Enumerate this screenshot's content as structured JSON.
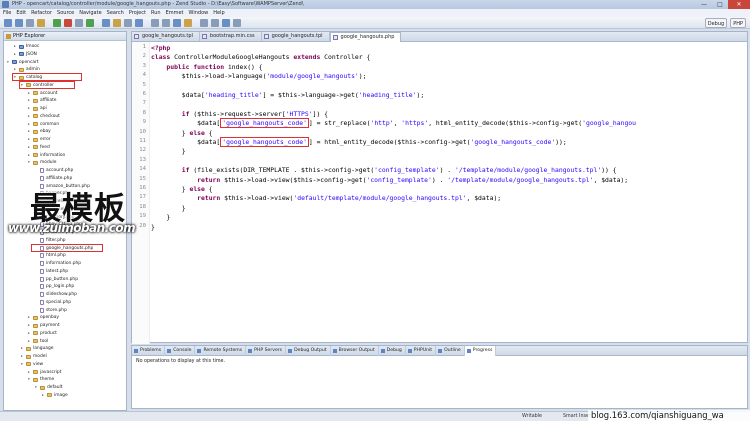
{
  "window": {
    "title": "PHP - opencart/catalog/controller/module/google_hangouts.php - Zend Studio - D:\\Easy\\Software\\WAMPServer\\Zend\\",
    "minimize": "—",
    "maximize": "□",
    "close": "✕"
  },
  "menu": [
    "File",
    "Edit",
    "Refactor",
    "Source",
    "Navigate",
    "Search",
    "Project",
    "Run",
    "Emmet",
    "Window",
    "Help"
  ],
  "perspectives": [
    "Debug",
    "PHP"
  ],
  "explorer": {
    "title": "PHP Explorer",
    "nodes": [
      {
        "label": "Imooc",
        "depth": 1,
        "type": "proj"
      },
      {
        "label": "JSON",
        "depth": 1,
        "type": "proj"
      },
      {
        "label": "opencart",
        "depth": 0,
        "type": "proj",
        "expanded": true
      },
      {
        "label": "admin",
        "depth": 1,
        "type": "folder"
      },
      {
        "label": "catalog",
        "depth": 1,
        "type": "folder",
        "expanded": true
      },
      {
        "label": "controller",
        "depth": 2,
        "type": "folder",
        "expanded": true
      },
      {
        "label": "account",
        "depth": 3,
        "type": "folder"
      },
      {
        "label": "affiliate",
        "depth": 3,
        "type": "folder"
      },
      {
        "label": "api",
        "depth": 3,
        "type": "folder"
      },
      {
        "label": "checkout",
        "depth": 3,
        "type": "folder"
      },
      {
        "label": "common",
        "depth": 3,
        "type": "folder"
      },
      {
        "label": "ebay",
        "depth": 3,
        "type": "folder"
      },
      {
        "label": "error",
        "depth": 3,
        "type": "folder"
      },
      {
        "label": "feed",
        "depth": 3,
        "type": "folder"
      },
      {
        "label": "information",
        "depth": 3,
        "type": "folder"
      },
      {
        "label": "module",
        "depth": 3,
        "type": "folder",
        "expanded": true
      },
      {
        "label": "account.php",
        "depth": 4,
        "type": "file"
      },
      {
        "label": "affiliate.php",
        "depth": 4,
        "type": "file"
      },
      {
        "label": "amazon_button.php",
        "depth": 4,
        "type": "file"
      },
      {
        "label": "banner.php",
        "depth": 4,
        "type": "file"
      },
      {
        "label": "bestseller.php",
        "depth": 4,
        "type": "file"
      },
      {
        "label": "carousel.php",
        "depth": 4,
        "type": "file"
      },
      {
        "label": "category.php",
        "depth": 4,
        "type": "file"
      },
      {
        "label": "ebay_listing.php",
        "depth": 4,
        "type": "file"
      },
      {
        "label": "featured.php",
        "depth": 4,
        "type": "file"
      },
      {
        "label": "filter.php",
        "depth": 4,
        "type": "file"
      },
      {
        "label": "google_hangouts.php",
        "depth": 4,
        "type": "file"
      },
      {
        "label": "html.php",
        "depth": 4,
        "type": "file"
      },
      {
        "label": "information.php",
        "depth": 4,
        "type": "file"
      },
      {
        "label": "latest.php",
        "depth": 4,
        "type": "file"
      },
      {
        "label": "pp_button.php",
        "depth": 4,
        "type": "file"
      },
      {
        "label": "pp_login.php",
        "depth": 4,
        "type": "file"
      },
      {
        "label": "slideshow.php",
        "depth": 4,
        "type": "file"
      },
      {
        "label": "special.php",
        "depth": 4,
        "type": "file"
      },
      {
        "label": "store.php",
        "depth": 4,
        "type": "file"
      },
      {
        "label": "openbay",
        "depth": 3,
        "type": "folder"
      },
      {
        "label": "payment",
        "depth": 3,
        "type": "folder"
      },
      {
        "label": "product",
        "depth": 3,
        "type": "folder"
      },
      {
        "label": "tool",
        "depth": 3,
        "type": "folder"
      },
      {
        "label": "language",
        "depth": 2,
        "type": "folder"
      },
      {
        "label": "model",
        "depth": 2,
        "type": "folder"
      },
      {
        "label": "view",
        "depth": 2,
        "type": "folder",
        "expanded": true
      },
      {
        "label": "javascript",
        "depth": 3,
        "type": "folder"
      },
      {
        "label": "theme",
        "depth": 3,
        "type": "folder",
        "expanded": true
      },
      {
        "label": "default",
        "depth": 4,
        "type": "folder",
        "expanded": true
      },
      {
        "label": "image",
        "depth": 5,
        "type": "folder"
      }
    ]
  },
  "tabs": [
    "google_hangouts.tpl",
    "bootstrap.min.css",
    "google_hangouts.tpl",
    "google_hangouts.php"
  ],
  "code": {
    "lines": [
      [
        [
          "tag",
          "<?php"
        ]
      ],
      [
        [
          "kw",
          "class "
        ],
        [
          "t",
          "ControllerModuleGoogleHangouts "
        ],
        [
          "kw",
          "extends "
        ],
        [
          "t",
          "Controller {"
        ]
      ],
      [
        [
          "t",
          "    "
        ],
        [
          "kw",
          "public function "
        ],
        [
          "t",
          "index() {"
        ]
      ],
      [
        [
          "t",
          "        $this->load->language("
        ],
        [
          "str",
          "'module/google_hangouts'"
        ],
        [
          "t",
          ");"
        ]
      ],
      [
        [
          "t",
          ""
        ]
      ],
      [
        [
          "t",
          "        $data["
        ],
        [
          "str",
          "'heading_title'"
        ],
        [
          "t",
          "] = $this->language->get("
        ],
        [
          "str",
          "'heading_title'"
        ],
        [
          "t",
          ");"
        ]
      ],
      [
        [
          "t",
          ""
        ]
      ],
      [
        [
          "t",
          "        "
        ],
        [
          "kw",
          "if "
        ],
        [
          "t",
          "($this->request->server["
        ],
        [
          "str",
          "'HTTPS'"
        ],
        [
          "t",
          "]) {"
        ]
      ],
      [
        [
          "t",
          "            $data["
        ],
        [
          "strb",
          "'google_hangouts_code'"
        ],
        [
          "t",
          "] = str_replace("
        ],
        [
          "str",
          "'http'"
        ],
        [
          "t",
          ", "
        ],
        [
          "str",
          "'https'"
        ],
        [
          "t",
          ", html_entity_decode($this->config->get("
        ],
        [
          "str",
          "'google_hangou"
        ]
      ],
      [
        [
          "t",
          "        } "
        ],
        [
          "kw",
          "else "
        ],
        [
          "t",
          "{"
        ]
      ],
      [
        [
          "t",
          "            $data["
        ],
        [
          "strb",
          "'google_hangouts_code'"
        ],
        [
          "t",
          "] = html_entity_decode($this->config->get("
        ],
        [
          "str",
          "'google_hangouts_code'"
        ],
        [
          "t",
          "));"
        ]
      ],
      [
        [
          "t",
          "        }"
        ]
      ],
      [
        [
          "t",
          ""
        ]
      ],
      [
        [
          "t",
          "        "
        ],
        [
          "kw",
          "if "
        ],
        [
          "t",
          "(file_exists(DIR_TEMPLATE . $this->config->get("
        ],
        [
          "str",
          "'config_template'"
        ],
        [
          "t",
          ") . "
        ],
        [
          "str",
          "'/template/module/google_hangouts.tpl'"
        ],
        [
          "t",
          ")) {"
        ]
      ],
      [
        [
          "t",
          "            "
        ],
        [
          "kw",
          "return "
        ],
        [
          "t",
          "$this->load->view($this->config->get("
        ],
        [
          "str",
          "'config_template'"
        ],
        [
          "t",
          ") . "
        ],
        [
          "str",
          "'/template/module/google_hangouts.tpl'"
        ],
        [
          "t",
          ", $data);"
        ]
      ],
      [
        [
          "t",
          "        } "
        ],
        [
          "kw",
          "else "
        ],
        [
          "t",
          "{"
        ]
      ],
      [
        [
          "t",
          "            "
        ],
        [
          "kw",
          "return "
        ],
        [
          "t",
          "$this->load->view("
        ],
        [
          "str",
          "'default/template/module/google_hangouts.tpl'"
        ],
        [
          "t",
          ", $data);"
        ]
      ],
      [
        [
          "t",
          "        }"
        ]
      ],
      [
        [
          "t",
          "    }"
        ]
      ],
      [
        [
          "t",
          "}"
        ]
      ]
    ]
  },
  "bottom": {
    "tabs": [
      "Problems",
      "Console",
      "Remote Systems",
      "PHP Servers",
      "Debug Output",
      "Browser Output",
      "Debug",
      "PHPUnit",
      "Outline",
      "Progress"
    ],
    "active": "Progress",
    "message": "No operations to display at this time."
  },
  "status": {
    "writable": "Writable",
    "insert": "Smart Insert",
    "position": "1 : 1"
  },
  "watermark": {
    "main": "最模板",
    "site": "www.zuimoban.com",
    "blog": "blog.163.com/qianshiguang_wa"
  }
}
